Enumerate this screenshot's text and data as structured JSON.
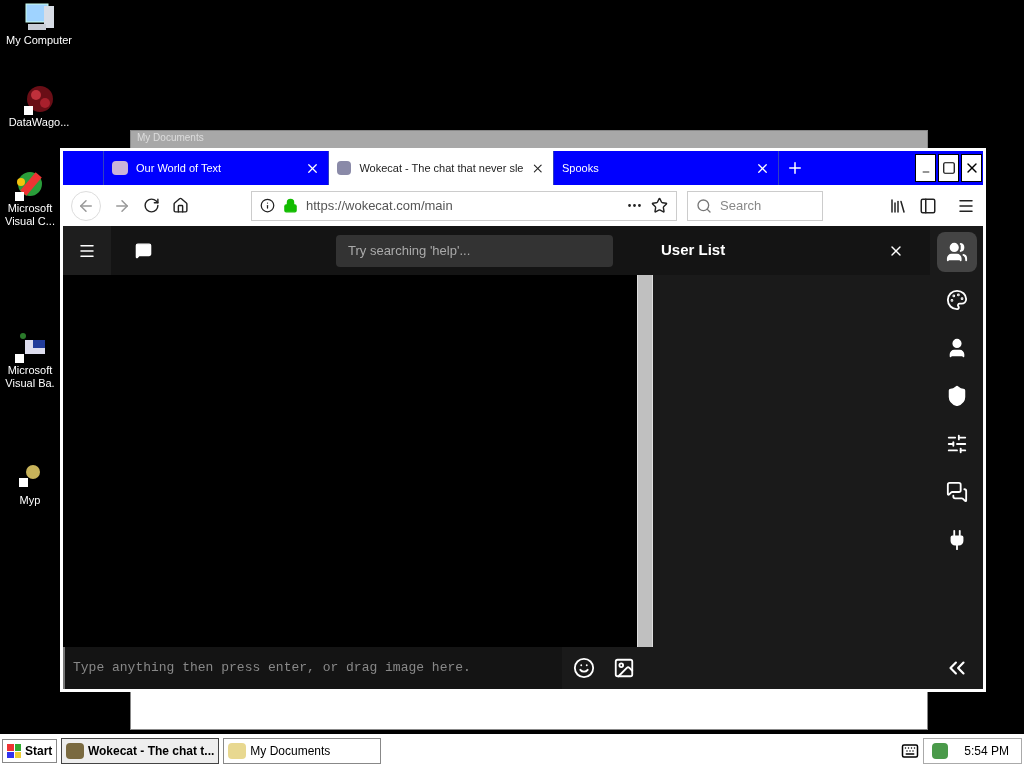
{
  "desktop_icons": [
    {
      "kind": "computer",
      "lines": [
        "My Computer"
      ]
    },
    {
      "kind": "network",
      "lines": [
        "DataWago..."
      ]
    },
    {
      "kind": "studio",
      "lines": [
        "Microsoft",
        "Visual C..."
      ]
    },
    {
      "kind": "basic",
      "lines": [
        "Microsoft",
        "Visual Ba."
      ]
    },
    {
      "kind": "shortcut",
      "lines": [
        "Myp"
      ]
    }
  ],
  "background_window": {
    "title": "My Documents"
  },
  "browser": {
    "tabs": [
      {
        "title": "Our World of Text",
        "selected": false
      },
      {
        "title": "Wokecat - The chat that never sle",
        "selected": true
      },
      {
        "title": "Spooks",
        "selected": false
      }
    ],
    "url": "https://wokecat.com/main",
    "search_placeholder": "Search"
  },
  "chat": {
    "search_placeholder": "Try searching 'help'...",
    "message_placeholder": "Type anything then press enter, or drag image here.",
    "panel_title": "User List",
    "rail": [
      {
        "kind": "users",
        "selected": true
      },
      {
        "kind": "palette",
        "selected": false
      },
      {
        "kind": "user",
        "selected": false
      },
      {
        "kind": "shield",
        "selected": false
      },
      {
        "kind": "sliders",
        "selected": false
      },
      {
        "kind": "chats",
        "selected": false
      },
      {
        "kind": "plug",
        "selected": false
      }
    ]
  },
  "taskbar": {
    "start": "Start",
    "tasks": [
      {
        "label": "Wokecat - The chat t...",
        "selected": true
      },
      {
        "label": "My Documents",
        "selected": false
      }
    ],
    "clock": "5:54 PM"
  }
}
